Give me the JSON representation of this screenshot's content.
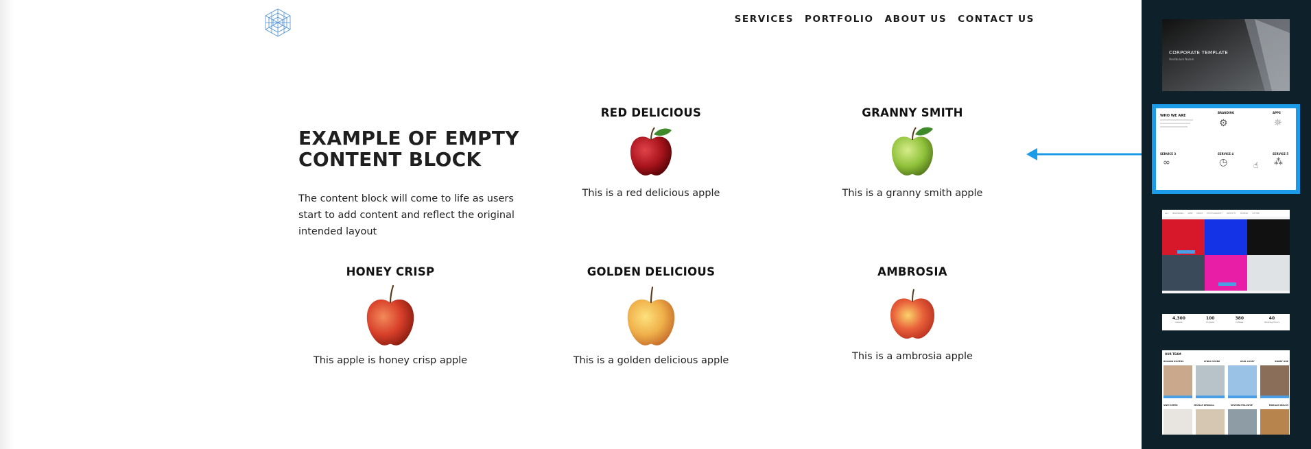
{
  "nav": {
    "items": [
      {
        "label": "SERVICES"
      },
      {
        "label": "PORTFOLIO"
      },
      {
        "label": "ABOUT US"
      },
      {
        "label": "CONTACT US"
      }
    ]
  },
  "intro": {
    "title": "EXAMPLE OF EMPTY CONTENT BLOCK",
    "body": "The content block will come to life as users start to add content and reflect the original intended layout"
  },
  "apples": [
    {
      "name": "RED DELICIOUS",
      "caption": "This is a red delicious apple",
      "color": "#a8141c"
    },
    {
      "name": "GRANNY SMITH",
      "caption": "This is a granny smith apple",
      "color": "#8fc13a"
    },
    {
      "name": "HONEY CRISP",
      "caption": "This apple is honey crisp apple",
      "color": "#d8402a"
    },
    {
      "name": "GOLDEN DELICIOUS",
      "caption": "This is a golden delicious apple",
      "color": "#efb04a"
    },
    {
      "name": "AMBROSIA",
      "caption": "This is a ambrosia apple",
      "color": "#e8603a"
    }
  ],
  "panel": {
    "thumb1": {
      "title": "CORPORATE TEMPLATE",
      "subtitle": "Vestibulum Nulam"
    },
    "thumb2": {
      "intro": "WHO WE ARE",
      "services": [
        "BRANDING",
        "APPS",
        "SERVICE 3",
        "SERVICE 4",
        "SERVICE 5"
      ]
    },
    "thumb3": {
      "tabs": [
        "ALL",
        "BRANDING",
        "WEB",
        "PRINT",
        "PHOTOGRAPHY",
        "IDENTITY",
        "MOBILE",
        "OTHER"
      ]
    },
    "thumb4": {
      "stats": [
        {
          "value": "4,300",
          "label": "Clients"
        },
        {
          "value": "100",
          "label": "Projects"
        },
        {
          "value": "380",
          "label": "Coffees"
        },
        {
          "value": "40",
          "label": "Working Hours"
        }
      ]
    },
    "thumb5": {
      "title": "OUR TEAM",
      "members": [
        "ROLAND KISTERS",
        "LYNDA STONE",
        "KARL CASEY",
        "BOBBY DOE",
        "SWEI SPEED",
        "MAELLE KENDALL",
        "SEVERN PHILLSHIP",
        "MORGAN WALSH"
      ]
    }
  },
  "colors": {
    "accent": "#1b9be8",
    "panel": "#0e2029"
  }
}
